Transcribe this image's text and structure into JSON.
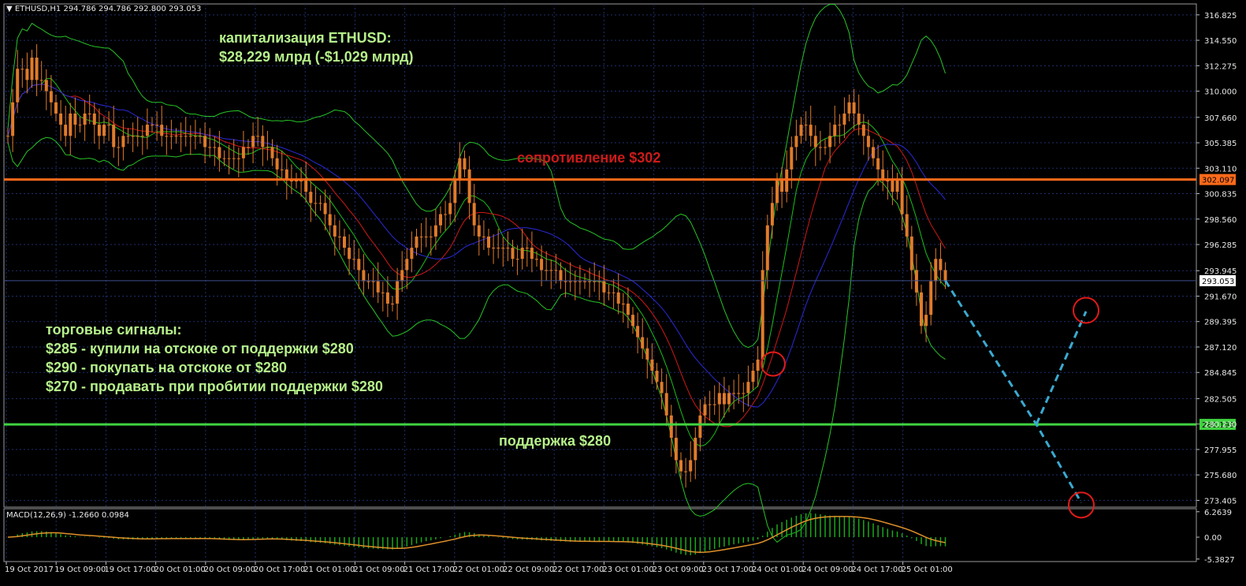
{
  "header": {
    "symbol": "ETHUSD,H1",
    "ohlc": "294.786 294.786 292.800 293.053"
  },
  "macd_header": "MACD(12,26,9) -1.2660 0.0984",
  "annotations": {
    "cap_title": "капитализация ETHUSD:",
    "cap_value": "$28,229 млрд (-$1,029 млрд)",
    "resistance": "сопротивление $302",
    "support": "поддержка $280",
    "signals_title": "торговые сигналы:",
    "signal_1": "$285 - купили на отскоке от поддержки $280",
    "signal_2": "$290 - покупать на отскоке от $280",
    "signal_3": "$270 - продавать при пробитии поддержки $280"
  },
  "colors": {
    "candle": "#e07b2b",
    "bollinger": "#27c427",
    "ma_fast": "#19c019",
    "ma_mid": "#d01818",
    "ma_slow": "#2a2ad8",
    "resistance": "#ff6a1a",
    "support": "#41d341",
    "forecast": "#3aaad0",
    "circle": "#e01a1a",
    "grid": "#1e2f6e",
    "macd_hist": "#1aa81a",
    "macd_signal": "#e0902a"
  },
  "chart_data": {
    "type": "candlestick",
    "y_ticks": [
      "316.825",
      "314.550",
      "312.275",
      "310.000",
      "307.660",
      "305.385",
      "303.110",
      "300.835",
      "298.560",
      "296.285",
      "293.945",
      "291.670",
      "289.395",
      "287.120",
      "284.845",
      "282.505",
      "280.230",
      "277.955",
      "275.680",
      "273.405"
    ],
    "x_ticks": [
      "19 Oct 2017",
      "19 Oct 09:00",
      "19 Oct 17:00",
      "20 Oct 01:00",
      "20 Oct 09:00",
      "20 Oct 17:00",
      "21 Oct 01:00",
      "21 Oct 09:00",
      "21 Oct 17:00",
      "22 Oct 01:00",
      "22 Oct 09:00",
      "22 Oct 17:00",
      "23 Oct 01:00",
      "23 Oct 09:00",
      "23 Oct 17:00",
      "24 Oct 01:00",
      "24 Oct 09:00",
      "24 Oct 17:00",
      "25 Oct 01:00"
    ],
    "ylim": [
      272.8,
      317.8
    ],
    "current_price": "293.053",
    "resistance": {
      "value": 302.097,
      "label": "302.097"
    },
    "support": {
      "value": 280.199,
      "label": "280.199"
    },
    "close": [
      306,
      309,
      312,
      312,
      311,
      313,
      311,
      311,
      310,
      309,
      308,
      307,
      306,
      308,
      307,
      307,
      308,
      308,
      307,
      306,
      307,
      307,
      305,
      305,
      306,
      306,
      306,
      306,
      306,
      307,
      307,
      307,
      306,
      306,
      306,
      306,
      306,
      306,
      306,
      306,
      306,
      305,
      305,
      305,
      304,
      304,
      304,
      304,
      304,
      305,
      305,
      306,
      306,
      305,
      305,
      304,
      303,
      303,
      302,
      302,
      302,
      302,
      301,
      300,
      300,
      300,
      299,
      298,
      297,
      297,
      296,
      295,
      295,
      294,
      293,
      293,
      293,
      292,
      292,
      291,
      291,
      293,
      294,
      295,
      296,
      297,
      297,
      297,
      297,
      298,
      299,
      299,
      300,
      302,
      304,
      303,
      300,
      298,
      297,
      297,
      296,
      296,
      296,
      296,
      296,
      295,
      295,
      296,
      296,
      295,
      295,
      294,
      294,
      294,
      294,
      293,
      293,
      293,
      293,
      293,
      293,
      293,
      293,
      293,
      292,
      292,
      292,
      291,
      291,
      290,
      289,
      288,
      287,
      286,
      285,
      284,
      283,
      281,
      279,
      277,
      276,
      276,
      277,
      279,
      281,
      282,
      282,
      282,
      283,
      282,
      283,
      283,
      283,
      283,
      284,
      285,
      286,
      294,
      298,
      300,
      302,
      301,
      303,
      305,
      306,
      307,
      307,
      306,
      305,
      305,
      305,
      306,
      307,
      307,
      308,
      309,
      308,
      307,
      306,
      305,
      304,
      303,
      302,
      302,
      301,
      302,
      299,
      297,
      294,
      292,
      289,
      290,
      293,
      295,
      294,
      293
    ],
    "macd_yticks": [
      "6.2639",
      "0.00",
      "-5.3827"
    ],
    "macd_ylim": [
      -6.0,
      7.0
    ]
  }
}
